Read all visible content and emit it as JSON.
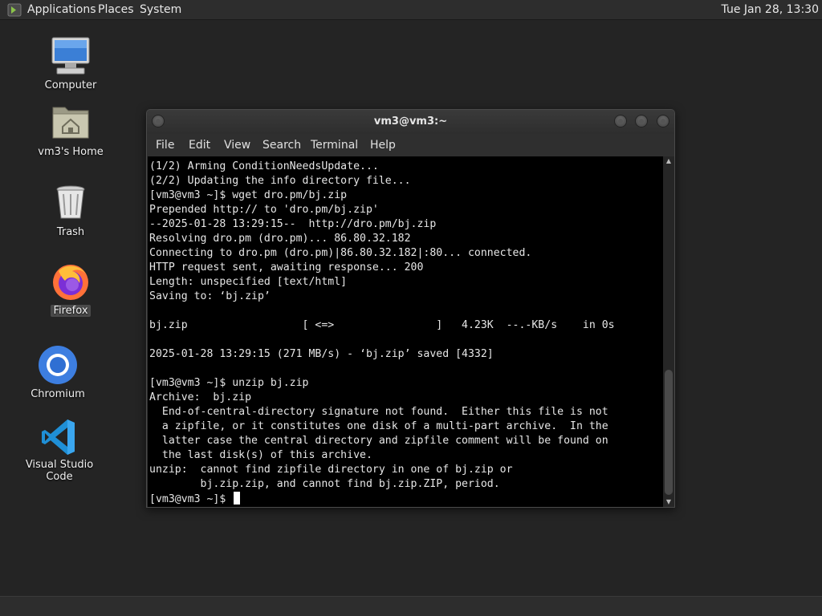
{
  "top_panel": {
    "applications": "Applications",
    "places": "Places",
    "system": "System",
    "clock": "Tue Jan 28, 13:30"
  },
  "desktop": {
    "icons": [
      {
        "label": "Computer",
        "icon": "computer-icon"
      },
      {
        "label": "vm3's Home",
        "icon": "home-folder-icon"
      },
      {
        "label": "Trash",
        "icon": "trash-icon"
      },
      {
        "label": "Firefox",
        "icon": "firefox-icon",
        "selected": true
      },
      {
        "label": "Chromium",
        "icon": "chromium-icon"
      },
      {
        "label": "Visual Studio Code",
        "icon": "vscode-icon"
      }
    ]
  },
  "terminal": {
    "title": "vm3@vm3:~",
    "menu": [
      "File",
      "Edit",
      "View",
      "Search",
      "Terminal",
      "Help"
    ],
    "lines": [
      "(1/2) Arming ConditionNeedsUpdate...",
      "(2/2) Updating the info directory file...",
      "[vm3@vm3 ~]$ wget dro.pm/bj.zip",
      "Prepended http:// to 'dro.pm/bj.zip'",
      "--2025-01-28 13:29:15--  http://dro.pm/bj.zip",
      "Resolving dro.pm (dro.pm)... 86.80.32.182",
      "Connecting to dro.pm (dro.pm)|86.80.32.182|:80... connected.",
      "HTTP request sent, awaiting response... 200",
      "Length: unspecified [text/html]",
      "Saving to: ‘bj.zip’",
      "",
      "bj.zip                  [ <=>                ]   4.23K  --.-KB/s    in 0s",
      "",
      "2025-01-28 13:29:15 (271 MB/s) - ‘bj.zip’ saved [4332]",
      "",
      "[vm3@vm3 ~]$ unzip bj.zip",
      "Archive:  bj.zip",
      "  End-of-central-directory signature not found.  Either this file is not",
      "  a zipfile, or it constitutes one disk of a multi-part archive.  In the",
      "  latter case the central directory and zipfile comment will be found on",
      "  the last disk(s) of this archive.",
      "unzip:  cannot find zipfile directory in one of bj.zip or",
      "        bj.zip.zip, and cannot find bj.zip.ZIP, period.",
      "[vm3@vm3 ~]$ "
    ]
  }
}
